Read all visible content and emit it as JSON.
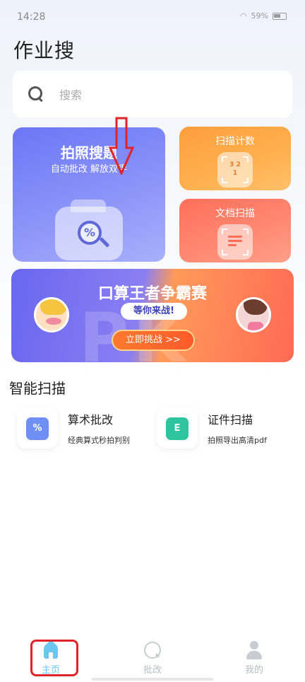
{
  "status_bar": {
    "time": "14:28",
    "battery": "59%"
  },
  "header": {
    "title": "作业搜"
  },
  "search": {
    "placeholder": "搜索"
  },
  "feature_cards": {
    "photo_search": {
      "title": "拍照搜题",
      "subtitle": "自动批改 解放双手",
      "icon": "camera-math-icon"
    },
    "scan_count": {
      "label": "扫描计数",
      "icon": "scan-count-icon",
      "glyph": "3 2 1"
    },
    "doc_scan": {
      "label": "文档扫描",
      "icon": "document-scan-icon"
    }
  },
  "banner": {
    "title": "口算王者争霸赛",
    "subtitle": "等你来战!",
    "button": "立即挑战 >>",
    "background_text": "PK"
  },
  "section": {
    "title": "智能扫描"
  },
  "tools": [
    {
      "name": "算术批改",
      "desc": "经典算式秒拍判别",
      "icon": "arithmetic-check-icon",
      "glyph": "%",
      "color": "#6f8ff5"
    },
    {
      "name": "证件扫描",
      "desc": "拍照导出高清pdf",
      "icon": "id-scan-icon",
      "glyph": "E",
      "color": "#2fc4a0"
    }
  ],
  "tabbar": {
    "items": [
      {
        "label": "主页",
        "icon": "home-icon",
        "active": true
      },
      {
        "label": "批改",
        "icon": "search-circle-icon",
        "active": false
      },
      {
        "label": "我的",
        "icon": "person-icon",
        "active": false
      }
    ]
  },
  "colors": {
    "active_tab": "#6cc7ef",
    "inactive_tab": "#c9ccd2",
    "annotation_red": "#e0242a"
  }
}
